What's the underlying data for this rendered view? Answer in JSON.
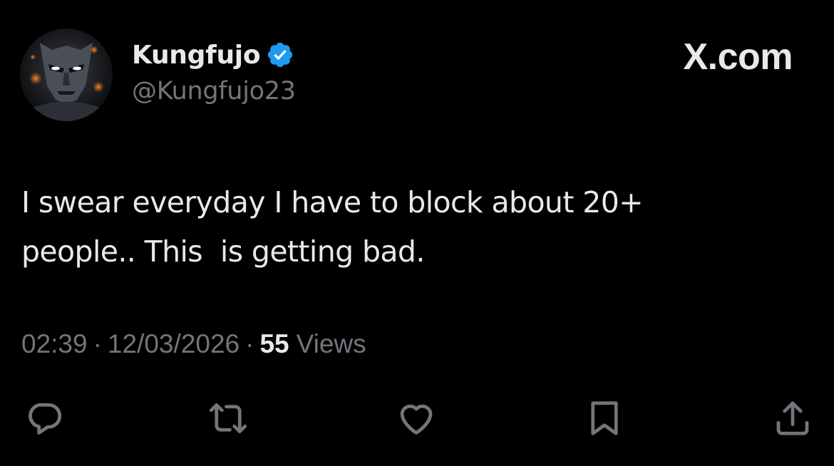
{
  "header": {
    "display_name": "Kungfujo",
    "handle": "@Kungfujo23",
    "verified_icon": "verified-badge-icon",
    "brand": "X.com"
  },
  "tweet": {
    "text": "I swear everyday I have to block about 20+\npeople.. This  is getting bad."
  },
  "meta": {
    "time": "02:39",
    "separator": "·",
    "date": "12/03/2026",
    "views_count": "55",
    "views_label": "Views"
  },
  "actions": [
    {
      "name": "reply",
      "icon": "reply-icon"
    },
    {
      "name": "repost",
      "icon": "repost-icon"
    },
    {
      "name": "like",
      "icon": "heart-icon"
    },
    {
      "name": "bookmark",
      "icon": "bookmark-icon"
    },
    {
      "name": "share",
      "icon": "share-icon"
    }
  ],
  "colors": {
    "background": "#000000",
    "text_primary": "#e7e9ea",
    "text_secondary": "#71767b",
    "verified": "#1d9bf0"
  }
}
